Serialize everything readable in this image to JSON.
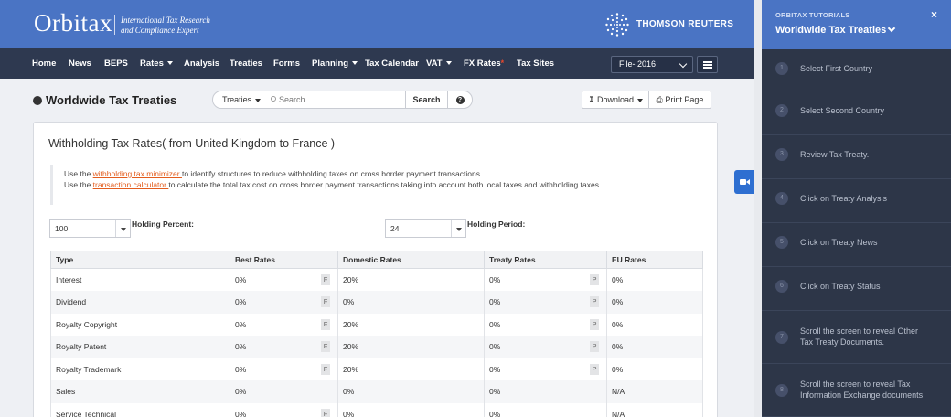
{
  "header": {
    "logo_text": "Orbitax",
    "tagline_line1": "International Tax Research",
    "tagline_line2": "and Compliance Expert",
    "partner": "THOMSON REUTERS"
  },
  "nav": {
    "items": [
      {
        "label": "Home",
        "dropdown": false
      },
      {
        "label": "News",
        "dropdown": false
      },
      {
        "label": "BEPS",
        "dropdown": false
      },
      {
        "label": "Rates",
        "dropdown": true
      },
      {
        "label": "Analysis",
        "dropdown": false
      },
      {
        "label": "Treaties",
        "dropdown": false
      },
      {
        "label": "Forms",
        "dropdown": false
      },
      {
        "label": "Planning",
        "dropdown": true
      },
      {
        "label": "Tax Calendar",
        "dropdown": false
      },
      {
        "label": "VAT",
        "dropdown": true
      },
      {
        "label": "FX Rates",
        "dropdown": false,
        "star": "*"
      },
      {
        "label": "Tax Sites",
        "dropdown": false
      }
    ],
    "file_select": "File- 2016"
  },
  "toolbar": {
    "page_title": "Worldwide Tax Treaties",
    "treaties_label": "Treaties",
    "search_placeholder": "Search",
    "search_button": "Search",
    "help_label": "?",
    "download_label": "Download",
    "print_label": "Print Page"
  },
  "content": {
    "title": "Withholding Tax Rates( from United Kingdom to France )",
    "note1_pre": "Use the ",
    "note1_link": "withholding tax minimizer ",
    "note1_post": "to identify structures to reduce withholding taxes on cross border payment transactions",
    "note2_pre": "Use the ",
    "note2_link": "transaction calculator ",
    "note2_post": "to calculate the total tax cost on cross border payment transactions taking into account both local taxes and withholding taxes.",
    "holding_percent_value": "100",
    "holding_percent_label": "Holding Percent:",
    "holding_period_value": "24",
    "holding_period_label": "Holding Period:"
  },
  "table": {
    "headers": [
      "Type",
      "Best Rates",
      "Domestic Rates",
      "Treaty Rates",
      "EU Rates"
    ],
    "rows": [
      {
        "type": "Interest",
        "best": "0%",
        "best_tag": "F",
        "domestic": "20%",
        "treaty": "0%",
        "treaty_tag": "P",
        "eu": "0%"
      },
      {
        "type": "Dividend",
        "best": "0%",
        "best_tag": "F",
        "domestic": "0%",
        "treaty": "0%",
        "treaty_tag": "P",
        "eu": "0%"
      },
      {
        "type": "Royalty Copyright",
        "best": "0%",
        "best_tag": "F",
        "domestic": "20%",
        "treaty": "0%",
        "treaty_tag": "P",
        "eu": "0%"
      },
      {
        "type": "Royalty Patent",
        "best": "0%",
        "best_tag": "F",
        "domestic": "20%",
        "treaty": "0%",
        "treaty_tag": "P",
        "eu": "0%"
      },
      {
        "type": "Royalty Trademark",
        "best": "0%",
        "best_tag": "F",
        "domestic": "20%",
        "treaty": "0%",
        "treaty_tag": "P",
        "eu": "0%"
      },
      {
        "type": "Sales",
        "best": "0%",
        "best_tag": "",
        "domestic": "0%",
        "treaty": "0%",
        "treaty_tag": "",
        "eu": "N/A"
      },
      {
        "type": "Service Technical",
        "best": "0%",
        "best_tag": "F",
        "domestic": "0%",
        "treaty": "0%",
        "treaty_tag": "",
        "eu": "N/A"
      }
    ]
  },
  "panel": {
    "kicker": "ORBITAX TUTORIALS",
    "title": "Worldwide Tax Treaties",
    "close": "×",
    "steps": [
      {
        "num": "1",
        "text": "Select First Country"
      },
      {
        "num": "2",
        "text": "Select Second Country"
      },
      {
        "num": "3",
        "text": "Review Tax Treaty."
      },
      {
        "num": "4",
        "text": "Click on Treaty Analysis"
      },
      {
        "num": "5",
        "text": "Click on Treaty News"
      },
      {
        "num": "6",
        "text": "Click on Treaty Status"
      },
      {
        "num": "7",
        "text": "Scroll the screen to reveal Other Tax Treaty Documents."
      },
      {
        "num": "8",
        "text": "Scroll the screen to reveal Tax Information Exchange documents"
      }
    ]
  },
  "colors": {
    "header_blue": "#4a74c4",
    "nav_dark": "#2e3950",
    "panel_dark": "#2d3648",
    "link_orange": "#e35d1e",
    "camera_blue": "#2e6fd1"
  }
}
